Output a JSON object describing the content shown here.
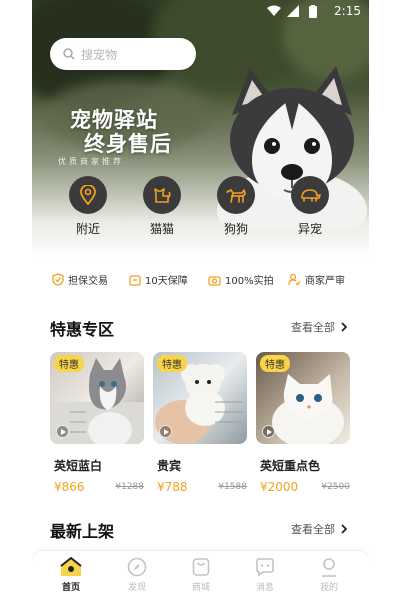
{
  "status_bar": {
    "time": "2:15"
  },
  "search": {
    "placeholder": "搜宠物"
  },
  "hero": {
    "title_line1": "宠物驿站",
    "title_line2": "终身售后",
    "subtitle": "优质商家推荐"
  },
  "categories": [
    {
      "label": "附近",
      "icon": "location-pin-icon"
    },
    {
      "label": "猫猫",
      "icon": "cat-icon"
    },
    {
      "label": "狗狗",
      "icon": "dog-icon"
    },
    {
      "label": "异宠",
      "icon": "turtle-icon"
    }
  ],
  "guarantees": [
    {
      "label": "担保交易",
      "icon": "shield-check-icon",
      "color": "#f5a01f"
    },
    {
      "label": "10天保障",
      "icon": "calendar-icon",
      "color": "#f5a01f"
    },
    {
      "label": "100%实拍",
      "icon": "camera-icon",
      "color": "#f5a01f"
    },
    {
      "label": "商家严审",
      "icon": "person-check-icon",
      "color": "#f5a01f"
    }
  ],
  "special": {
    "title": "特惠专区",
    "see_all": "查看全部",
    "items": [
      {
        "badge": "特惠",
        "name": "英短蓝白",
        "price": "¥866",
        "old_price": "¥1288"
      },
      {
        "badge": "特惠",
        "name": "贵宾",
        "price": "¥788",
        "old_price": "¥1588"
      },
      {
        "badge": "特惠",
        "name": "英短重点色",
        "price": "¥2000",
        "old_price": "¥2500"
      }
    ]
  },
  "latest": {
    "title": "最新上架",
    "see_all": "查看全部"
  },
  "nav": {
    "items": [
      {
        "label": "首页",
        "icon": "home-icon",
        "active": true
      },
      {
        "label": "发现",
        "icon": "compass-icon",
        "active": false
      },
      {
        "label": "商城",
        "icon": "shop-bag-icon",
        "active": false
      },
      {
        "label": "消息",
        "icon": "message-icon",
        "active": false
      },
      {
        "label": "我的",
        "icon": "profile-icon",
        "active": false
      }
    ]
  },
  "colors": {
    "accent": "#f5a01f",
    "badge": "#f9d448",
    "category_circle": "#3b3b3b"
  }
}
